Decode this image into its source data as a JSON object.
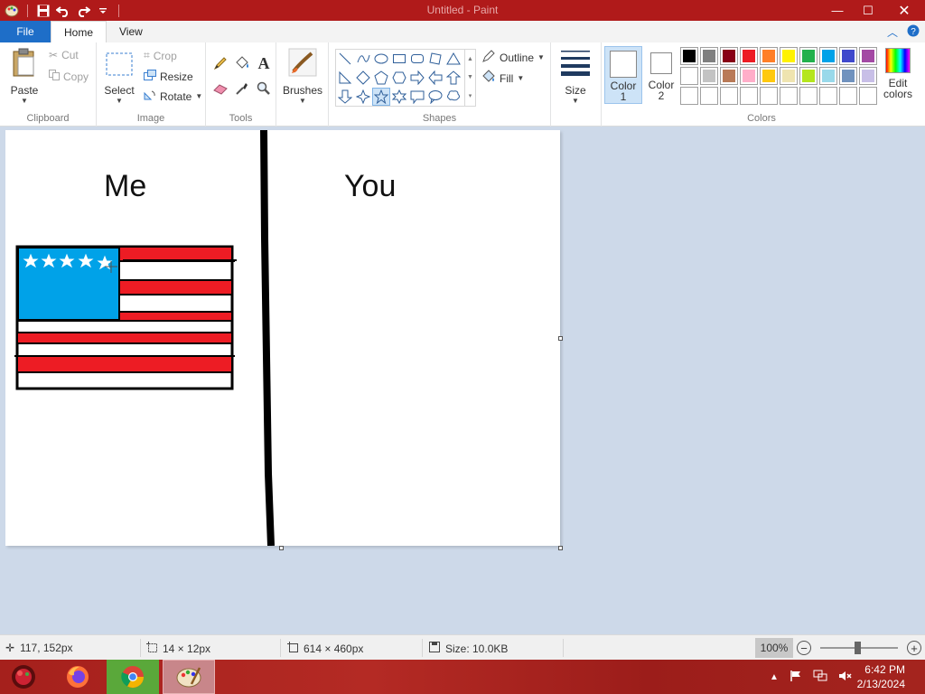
{
  "window": {
    "title": "Untitled - Paint",
    "minimize": "—",
    "maximize": "☐",
    "close": "✕"
  },
  "tabs": {
    "file": "File",
    "home": "Home",
    "view": "View"
  },
  "ribbon": {
    "clipboard": {
      "group_label": "Clipboard",
      "paste": "Paste",
      "cut": "Cut",
      "copy": "Copy"
    },
    "image": {
      "group_label": "Image",
      "select": "Select",
      "crop": "Crop",
      "resize": "Resize",
      "rotate": "Rotate"
    },
    "tools": {
      "group_label": "Tools"
    },
    "brushes": {
      "label": "Brushes"
    },
    "shapes": {
      "group_label": "Shapes",
      "outline": "Outline",
      "fill": "Fill"
    },
    "size": {
      "label": "Size"
    },
    "colors": {
      "group_label": "Colors",
      "color1_line1": "Color",
      "color1_line2": "1",
      "color2_line1": "Color",
      "color2_line2": "2",
      "edit_line1": "Edit",
      "edit_line2": "colors",
      "color1_value": "#ffffff",
      "color2_value": "#ffffff",
      "palette": [
        "#000000",
        "#7f7f7f",
        "#880015",
        "#ed1c24",
        "#ff7f27",
        "#fff200",
        "#22b14c",
        "#00a2e8",
        "#3f48cc",
        "#a349a4",
        "#ffffff",
        "#c3c3c3",
        "#b97a57",
        "#ffaec9",
        "#ffc90e",
        "#efe4b0",
        "#b5e61d",
        "#99d9ea",
        "#7092be",
        "#c8bfe7",
        "#ffffff",
        "#ffffff",
        "#ffffff",
        "#ffffff",
        "#ffffff",
        "#ffffff",
        "#ffffff",
        "#ffffff",
        "#ffffff",
        "#ffffff"
      ]
    }
  },
  "canvas": {
    "left_label": "Me",
    "right_label": "You",
    "flag_blue": "#00a2e8",
    "flag_red": "#ed1c24"
  },
  "status": {
    "cursor_pos": "117, 152px",
    "selection_size": "14 × 12px",
    "image_size": "614 × 460px",
    "file_size": "Size: 10.0KB",
    "zoom": "100%"
  },
  "taskbar": {
    "apps": [
      "windows-start",
      "firefox",
      "chrome",
      "paint"
    ],
    "time": "6:42 PM",
    "date": "2/13/2024"
  }
}
